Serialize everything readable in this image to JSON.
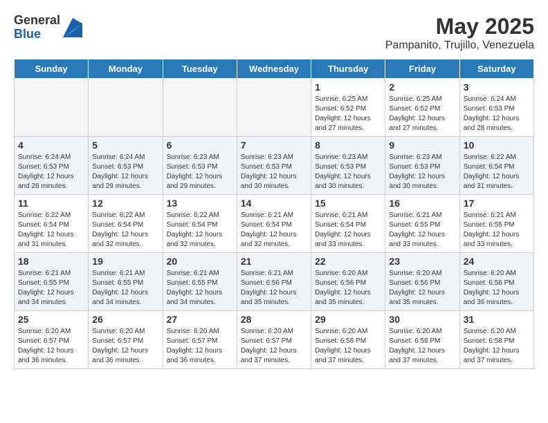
{
  "header": {
    "logo_general": "General",
    "logo_blue": "Blue",
    "month_year": "May 2025",
    "location": "Pampanito, Trujillo, Venezuela"
  },
  "days_of_week": [
    "Sunday",
    "Monday",
    "Tuesday",
    "Wednesday",
    "Thursday",
    "Friday",
    "Saturday"
  ],
  "weeks": [
    [
      {
        "day": "",
        "empty": true
      },
      {
        "day": "",
        "empty": true
      },
      {
        "day": "",
        "empty": true
      },
      {
        "day": "",
        "empty": true
      },
      {
        "day": "1",
        "sunrise": "6:25 AM",
        "sunset": "6:52 PM",
        "daylight": "12 hours and 27 minutes."
      },
      {
        "day": "2",
        "sunrise": "6:25 AM",
        "sunset": "6:52 PM",
        "daylight": "12 hours and 27 minutes."
      },
      {
        "day": "3",
        "sunrise": "6:24 AM",
        "sunset": "6:53 PM",
        "daylight": "12 hours and 28 minutes."
      }
    ],
    [
      {
        "day": "4",
        "sunrise": "6:24 AM",
        "sunset": "6:53 PM",
        "daylight": "12 hours and 28 minutes."
      },
      {
        "day": "5",
        "sunrise": "6:24 AM",
        "sunset": "6:53 PM",
        "daylight": "12 hours and 29 minutes."
      },
      {
        "day": "6",
        "sunrise": "6:23 AM",
        "sunset": "6:53 PM",
        "daylight": "12 hours and 29 minutes."
      },
      {
        "day": "7",
        "sunrise": "6:23 AM",
        "sunset": "6:53 PM",
        "daylight": "12 hours and 30 minutes."
      },
      {
        "day": "8",
        "sunrise": "6:23 AM",
        "sunset": "6:53 PM",
        "daylight": "12 hours and 30 minutes."
      },
      {
        "day": "9",
        "sunrise": "6:23 AM",
        "sunset": "6:53 PM",
        "daylight": "12 hours and 30 minutes."
      },
      {
        "day": "10",
        "sunrise": "6:22 AM",
        "sunset": "6:54 PM",
        "daylight": "12 hours and 31 minutes."
      }
    ],
    [
      {
        "day": "11",
        "sunrise": "6:22 AM",
        "sunset": "6:54 PM",
        "daylight": "12 hours and 31 minutes."
      },
      {
        "day": "12",
        "sunrise": "6:22 AM",
        "sunset": "6:54 PM",
        "daylight": "12 hours and 32 minutes."
      },
      {
        "day": "13",
        "sunrise": "6:22 AM",
        "sunset": "6:54 PM",
        "daylight": "12 hours and 32 minutes."
      },
      {
        "day": "14",
        "sunrise": "6:21 AM",
        "sunset": "6:54 PM",
        "daylight": "12 hours and 32 minutes."
      },
      {
        "day": "15",
        "sunrise": "6:21 AM",
        "sunset": "6:54 PM",
        "daylight": "12 hours and 33 minutes."
      },
      {
        "day": "16",
        "sunrise": "6:21 AM",
        "sunset": "6:55 PM",
        "daylight": "12 hours and 33 minutes."
      },
      {
        "day": "17",
        "sunrise": "6:21 AM",
        "sunset": "6:55 PM",
        "daylight": "12 hours and 33 minutes."
      }
    ],
    [
      {
        "day": "18",
        "sunrise": "6:21 AM",
        "sunset": "6:55 PM",
        "daylight": "12 hours and 34 minutes."
      },
      {
        "day": "19",
        "sunrise": "6:21 AM",
        "sunset": "6:55 PM",
        "daylight": "12 hours and 34 minutes."
      },
      {
        "day": "20",
        "sunrise": "6:21 AM",
        "sunset": "6:55 PM",
        "daylight": "12 hours and 34 minutes."
      },
      {
        "day": "21",
        "sunrise": "6:21 AM",
        "sunset": "6:56 PM",
        "daylight": "12 hours and 35 minutes."
      },
      {
        "day": "22",
        "sunrise": "6:20 AM",
        "sunset": "6:56 PM",
        "daylight": "12 hours and 35 minutes."
      },
      {
        "day": "23",
        "sunrise": "6:20 AM",
        "sunset": "6:56 PM",
        "daylight": "12 hours and 35 minutes."
      },
      {
        "day": "24",
        "sunrise": "6:20 AM",
        "sunset": "6:56 PM",
        "daylight": "12 hours and 36 minutes."
      }
    ],
    [
      {
        "day": "25",
        "sunrise": "6:20 AM",
        "sunset": "6:57 PM",
        "daylight": "12 hours and 36 minutes."
      },
      {
        "day": "26",
        "sunrise": "6:20 AM",
        "sunset": "6:57 PM",
        "daylight": "12 hours and 36 minutes."
      },
      {
        "day": "27",
        "sunrise": "6:20 AM",
        "sunset": "6:57 PM",
        "daylight": "12 hours and 36 minutes."
      },
      {
        "day": "28",
        "sunrise": "6:20 AM",
        "sunset": "6:57 PM",
        "daylight": "12 hours and 37 minutes."
      },
      {
        "day": "29",
        "sunrise": "6:20 AM",
        "sunset": "6:58 PM",
        "daylight": "12 hours and 37 minutes."
      },
      {
        "day": "30",
        "sunrise": "6:20 AM",
        "sunset": "6:58 PM",
        "daylight": "12 hours and 37 minutes."
      },
      {
        "day": "31",
        "sunrise": "6:20 AM",
        "sunset": "6:58 PM",
        "daylight": "12 hours and 37 minutes."
      }
    ]
  ]
}
